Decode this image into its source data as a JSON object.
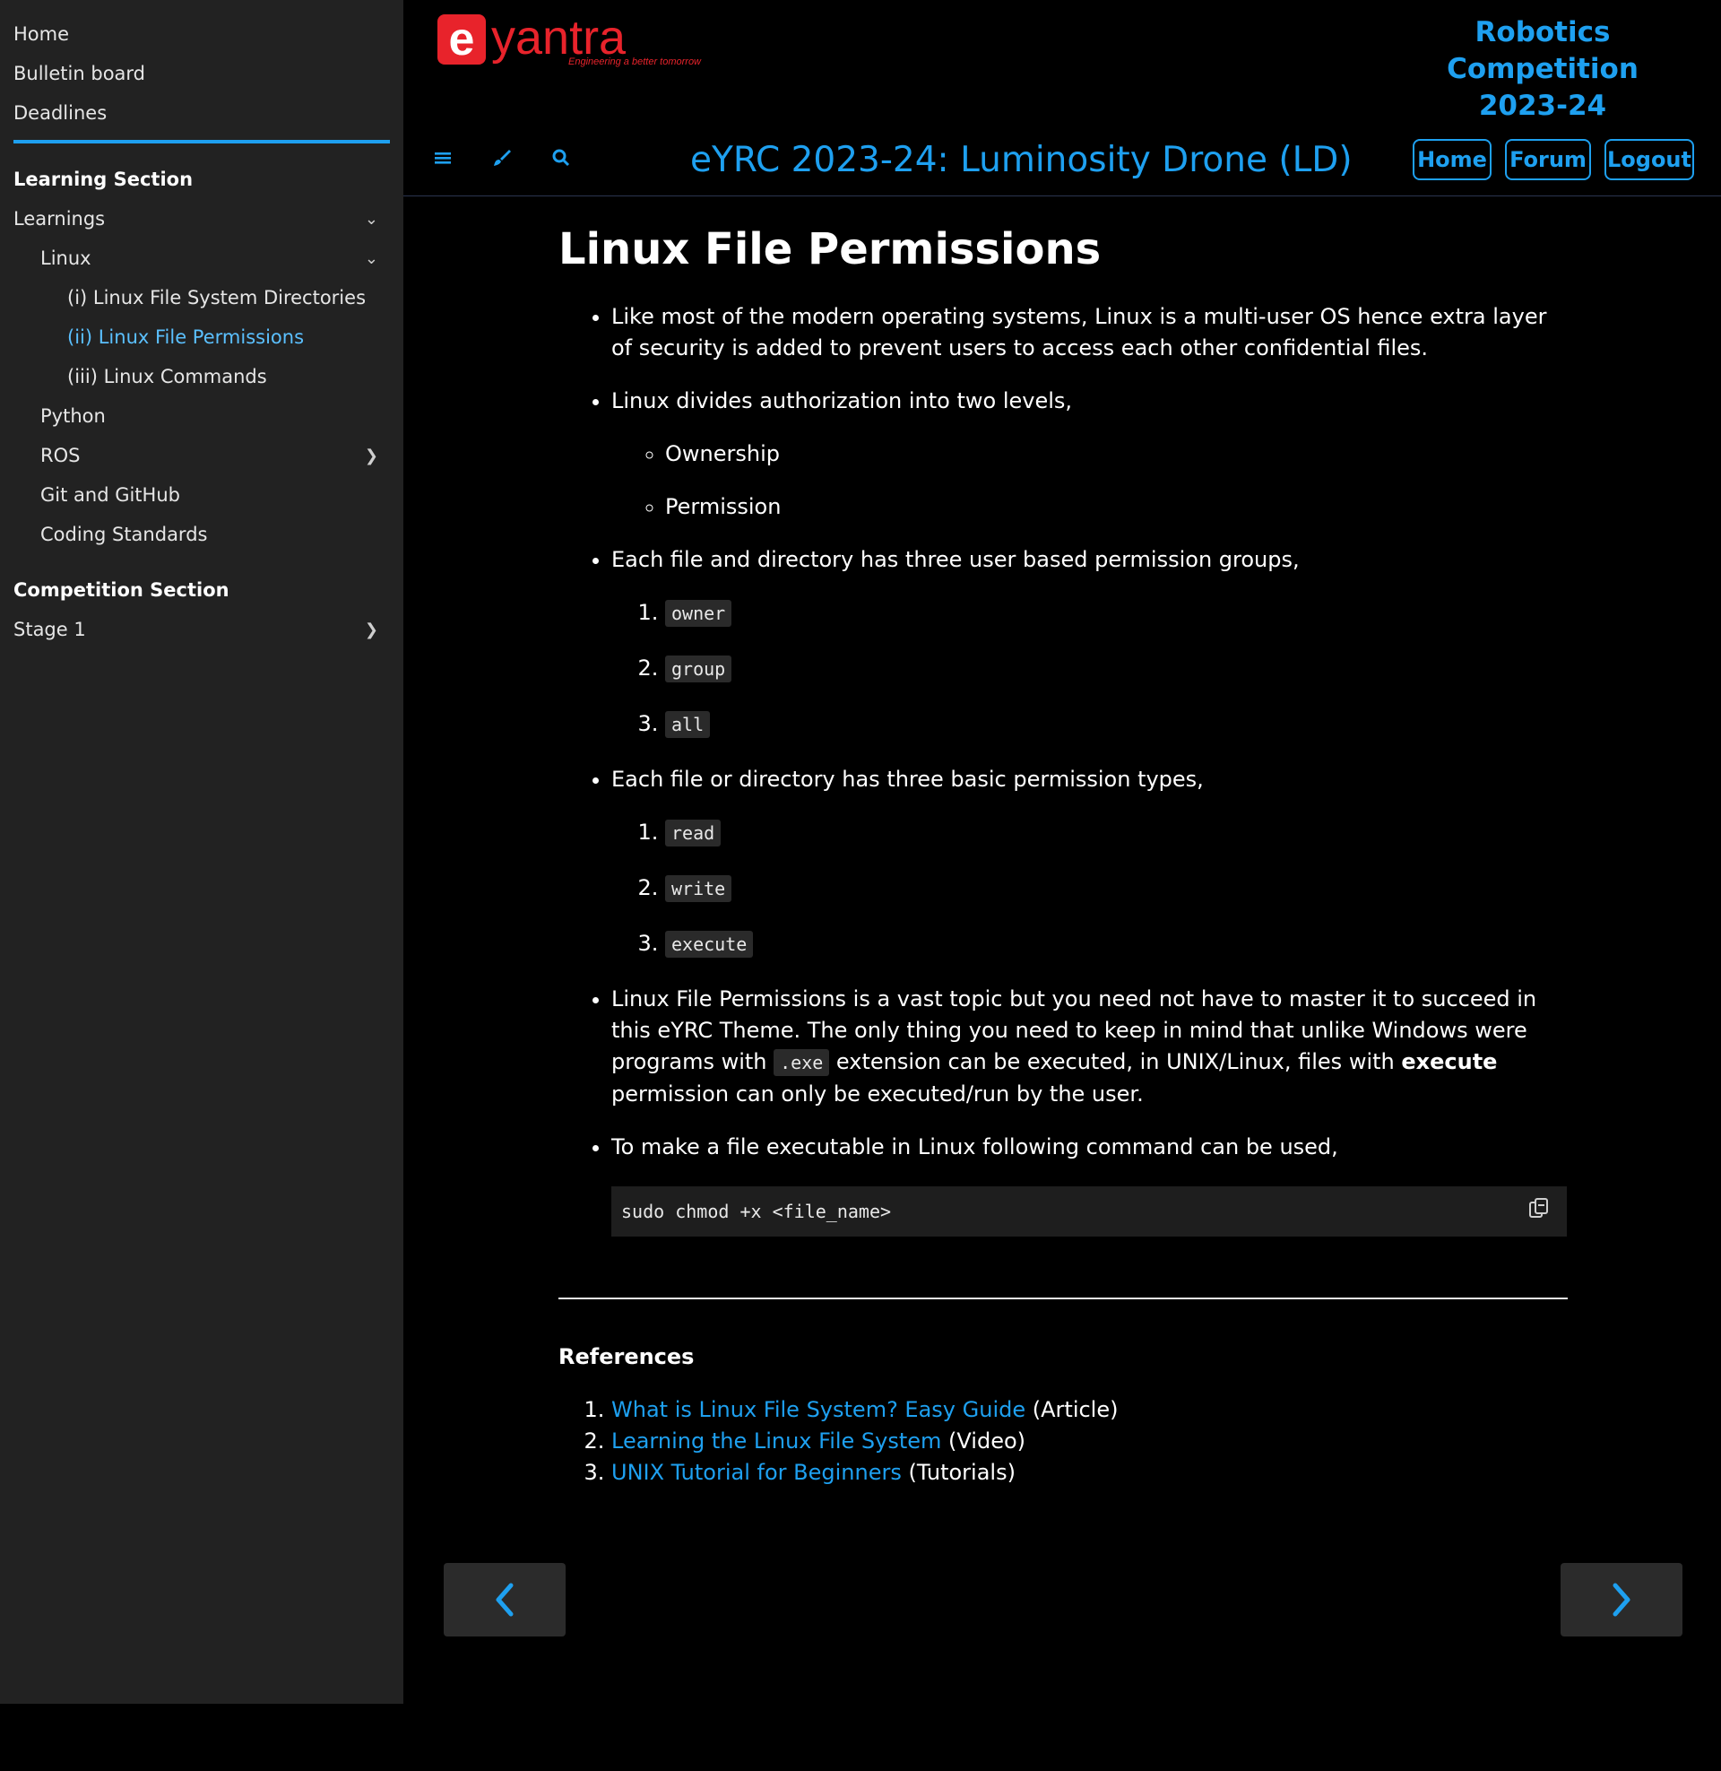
{
  "sidebar": {
    "top_links": [
      "Home",
      "Bulletin board",
      "Deadlines"
    ],
    "learning_section_title": "Learning Section",
    "learnings": {
      "label": "Learnings",
      "linux": {
        "label": "Linux",
        "children": [
          "(i) Linux File System Directories",
          "(ii) Linux File Permissions",
          "(iii) Linux Commands"
        ]
      },
      "python": "Python",
      "ros": "ROS",
      "git": "Git and GitHub",
      "coding": "Coding Standards"
    },
    "competition_section_title": "Competition Section",
    "stage1": "Stage 1"
  },
  "header": {
    "logo_text": "yantra",
    "logo_tagline": "Engineering a better tomorrow",
    "competition_line1": "Robotics Competition",
    "competition_line2": "2023-24",
    "page_title": "eYRC 2023-24: Luminosity Drone (LD)",
    "buttons": [
      "Home",
      "Forum",
      "Logout"
    ]
  },
  "article": {
    "title": "Linux File Permissions",
    "bullet1": "Like most of the modern operating systems, Linux is a multi-user OS hence extra layer of security is added to prevent users to access each other confidential files.",
    "bullet2": "Linux divides authorization into two levels,",
    "levels": [
      "Ownership",
      "Permission"
    ],
    "bullet3": "Each file and directory has three user based permission groups,",
    "groups": [
      "owner",
      "group",
      "all"
    ],
    "bullet4": "Each file or directory has three basic permission types,",
    "types": [
      "read",
      "write",
      "execute"
    ],
    "bullet5_a": "Linux File Permissions is a vast topic but you need not have to master it to succeed in this eYRC Theme. The only thing you need to keep in mind that unlike Windows were programs with ",
    "bullet5_code": ".exe",
    "bullet5_b": " extension can be executed, in UNIX/Linux, files with ",
    "bullet5_bold": "execute",
    "bullet5_c": " permission can only be executed/run by the user.",
    "bullet6": "To make a file executable in Linux following command can be used,",
    "code": "sudo chmod +x <file_name>",
    "references_title": "References",
    "references": [
      {
        "link": "What is Linux File System? Easy Guide",
        "type": " (Article)"
      },
      {
        "link": "Learning the Linux File System",
        "type": " (Video)"
      },
      {
        "link": "UNIX Tutorial for Beginners",
        "type": " (Tutorials)"
      }
    ]
  },
  "colors": {
    "accent": "#1ea0f0",
    "logo_red": "#e8232b",
    "sidebar_bg": "#222222"
  },
  "icons": {
    "menu": "menu-icon",
    "theme": "paintbrush-icon",
    "search": "search-icon",
    "copy": "copy-icon",
    "prev": "chevron-left-icon",
    "next": "chevron-right-icon"
  }
}
